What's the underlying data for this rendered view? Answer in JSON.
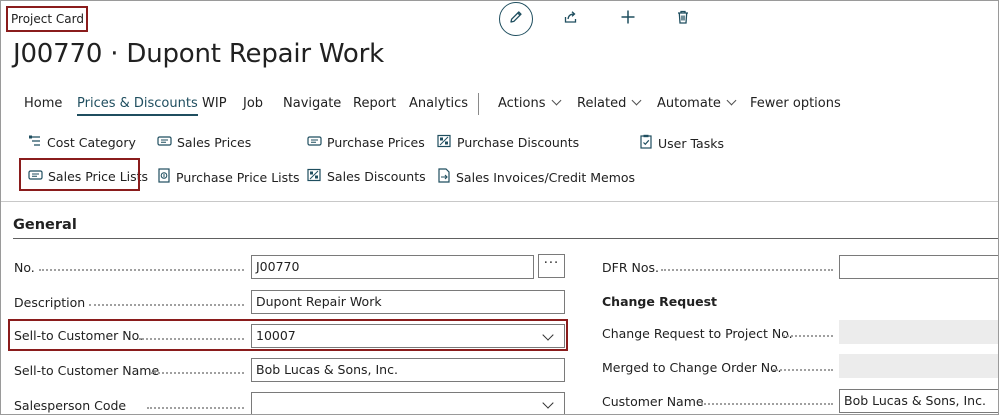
{
  "page": {
    "type_label": "Project Card",
    "title": "J00770 · Dupont Repair Work"
  },
  "toolbar": {
    "edit_icon": "pencil-icon",
    "share_icon": "share-icon",
    "new_icon": "plus-icon",
    "delete_icon": "trash-icon"
  },
  "menu": {
    "items": [
      "Home",
      "Prices & Discounts",
      "WIP",
      "Job",
      "Navigate",
      "Report",
      "Analytics"
    ],
    "dropdowns": [
      "Actions",
      "Related",
      "Automate"
    ],
    "fewer": "Fewer options",
    "active_index": 1
  },
  "actions": {
    "cost_category": "Cost Category",
    "sales_prices": "Sales Prices",
    "purchase_prices": "Purchase Prices",
    "purchase_discounts": "Purchase Discounts",
    "user_tasks": "User Tasks",
    "sales_price_lists": "Sales Price Lists",
    "purchase_price_lists": "Purchase Price Lists",
    "sales_discounts": "Sales Discounts",
    "sales_invoices": "Sales Invoices/Credit Memos"
  },
  "general": {
    "section_title": "General",
    "no_label": "No.",
    "no_value": "J00770",
    "desc_label": "Description",
    "desc_value": "Dupont Repair Work",
    "cust_no_label": "Sell-to Customer No.",
    "cust_no_value": "10007",
    "cust_name_label": "Sell-to Customer Name",
    "cust_name_value": "Bob Lucas & Sons, Inc.",
    "salesperson_label": "Salesperson Code",
    "salesperson_value": "",
    "ellipsis": "···"
  },
  "right": {
    "dfr_label": "DFR Nos.",
    "dfr_value": "",
    "change_request_heading": "Change Request",
    "cr_project_label": "Change Request to Project No.",
    "merged_label": "Merged to Change Order No.",
    "cust_name_label": "Customer Name",
    "cust_name_value": "Bob Lucas & Sons, Inc."
  },
  "colors": {
    "accent": "#1f4e5f",
    "highlight_box": "#8a1c1c"
  }
}
